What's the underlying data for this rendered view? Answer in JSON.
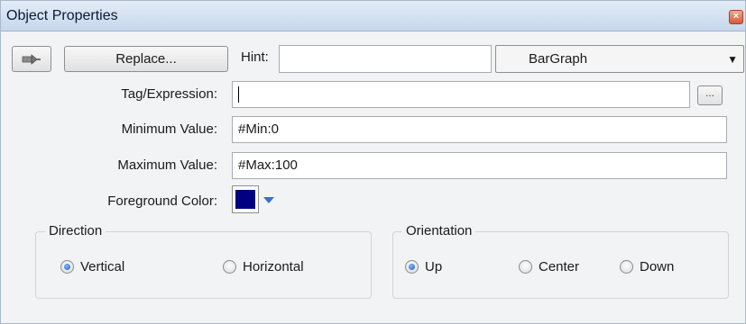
{
  "window": {
    "title": "Object Properties"
  },
  "toolbar": {
    "replace_label": "Replace...",
    "hint_label": "Hint:",
    "hint_value": "",
    "object_type": "BarGraph"
  },
  "fields": {
    "tag_label": "Tag/Expression:",
    "tag_value": "",
    "browse_label": "...",
    "min_label": "Minimum Value:",
    "min_value": "#Min:0",
    "max_label": "Maximum Value:",
    "max_value": "#Max:100",
    "fg_label": "Foreground Color:"
  },
  "colors": {
    "foreground": "#000080",
    "accent": "#3a6fcf"
  },
  "direction": {
    "title": "Direction",
    "options": [
      "Vertical",
      "Horizontal"
    ],
    "selected": "Vertical"
  },
  "orientation": {
    "title": "Orientation",
    "options": [
      "Up",
      "Center",
      "Down"
    ],
    "selected": "Up"
  }
}
